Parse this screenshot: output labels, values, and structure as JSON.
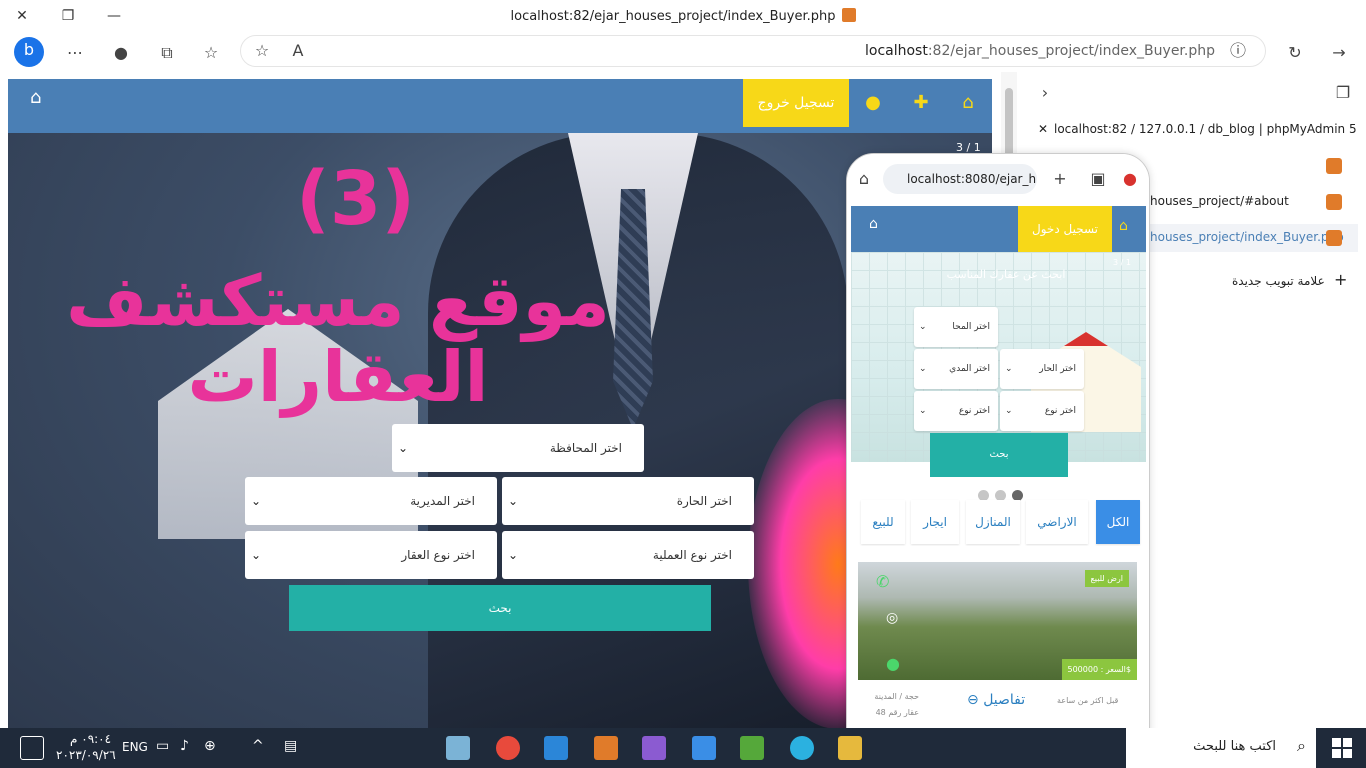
{
  "window": {
    "title": "localhost:82/ejar_houses_project/index_Buyer.php"
  },
  "toolbar": {
    "url_host": "localhost",
    "url_rest": ":82/ejar_houses_project/index_Buyer.php"
  },
  "site": {
    "logout_label": "تسجيل خروج",
    "slide_count": "3 / 1",
    "overlay_number": "(3)",
    "overlay_title": "موقع مستكشف العقارات",
    "select_governorate": "اختر المحافظة",
    "select_street": "اختر الحارة",
    "select_directorate": "اختر المديرية",
    "select_operation": "اختر نوع العملية",
    "select_property_type": "اختر نوع العقار",
    "search_label": "بحث"
  },
  "sidebar": {
    "tabs": [
      {
        "label": "localhost:82 / 127.0.0.1 / db_blog | phpMyAdmin 5"
      },
      {
        "label": ""
      },
      {
        "label": "houses_project/#about"
      },
      {
        "label": "houses_project/index_Buyer.php"
      }
    ],
    "new_tab_label": "علامة تبويب جديدة"
  },
  "phone": {
    "url": "localhost:8080/ejar_h",
    "login_label": "تسجيل دخول",
    "slide_count": "3 / 1",
    "hero_text": "ابحث عن عقارك المناسب",
    "select_area": "اختر المحا",
    "select_street": "اختر الحار",
    "select_directorate": "اختر المدي",
    "select_type": "اختر نوع",
    "select_type2": "اختر نوع",
    "search_label": "بحث",
    "tabs": [
      "الكل",
      "الاراضي",
      "المنازل",
      "ايجار",
      "للبيع"
    ],
    "card_badge": "ارض للبيع",
    "card_price": "السعر : 500000$",
    "card_details": "تفاصيل",
    "card_time": "قبل اكثر من ساعة",
    "card_location": "حجة / المدينة",
    "card_number": "عقار رقم 48"
  },
  "taskbar": {
    "search_placeholder": "اكتب هنا للبحث",
    "lang": "ENG",
    "time": "٠٩:٠٤ م",
    "date": "٢٠٢٣/٠٩/٢٦"
  }
}
